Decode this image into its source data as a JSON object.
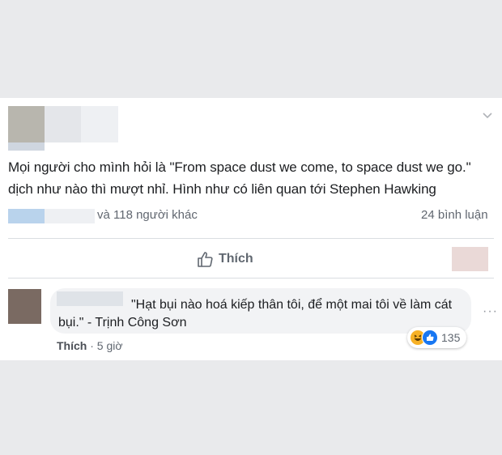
{
  "post": {
    "text": "Mọi người cho mình hỏi là \"From space dust we come, to space dust we go.\" dịch như nào thì mượt nhỉ. Hình như có liên quan tới Stephen Hawking",
    "reactions_text": "và 118 người khác",
    "comments_count": "24 bình luận",
    "like_label": "Thích"
  },
  "comment": {
    "text": "\"Hạt bụi nào hoá kiếp thân tôi, để một mai tôi về làm cát bụi.\" - Trịnh Công Sơn",
    "like_label": "Thích",
    "separator": "·",
    "time": "5 giờ",
    "reaction_count": "135",
    "more_icon": "···"
  },
  "colors": {
    "background": "#e9eaec",
    "card": "#ffffff",
    "text": "#1c1e21",
    "muted": "#606770",
    "like_blue": "#1877f2",
    "haha_yellow": "#f7b125"
  }
}
